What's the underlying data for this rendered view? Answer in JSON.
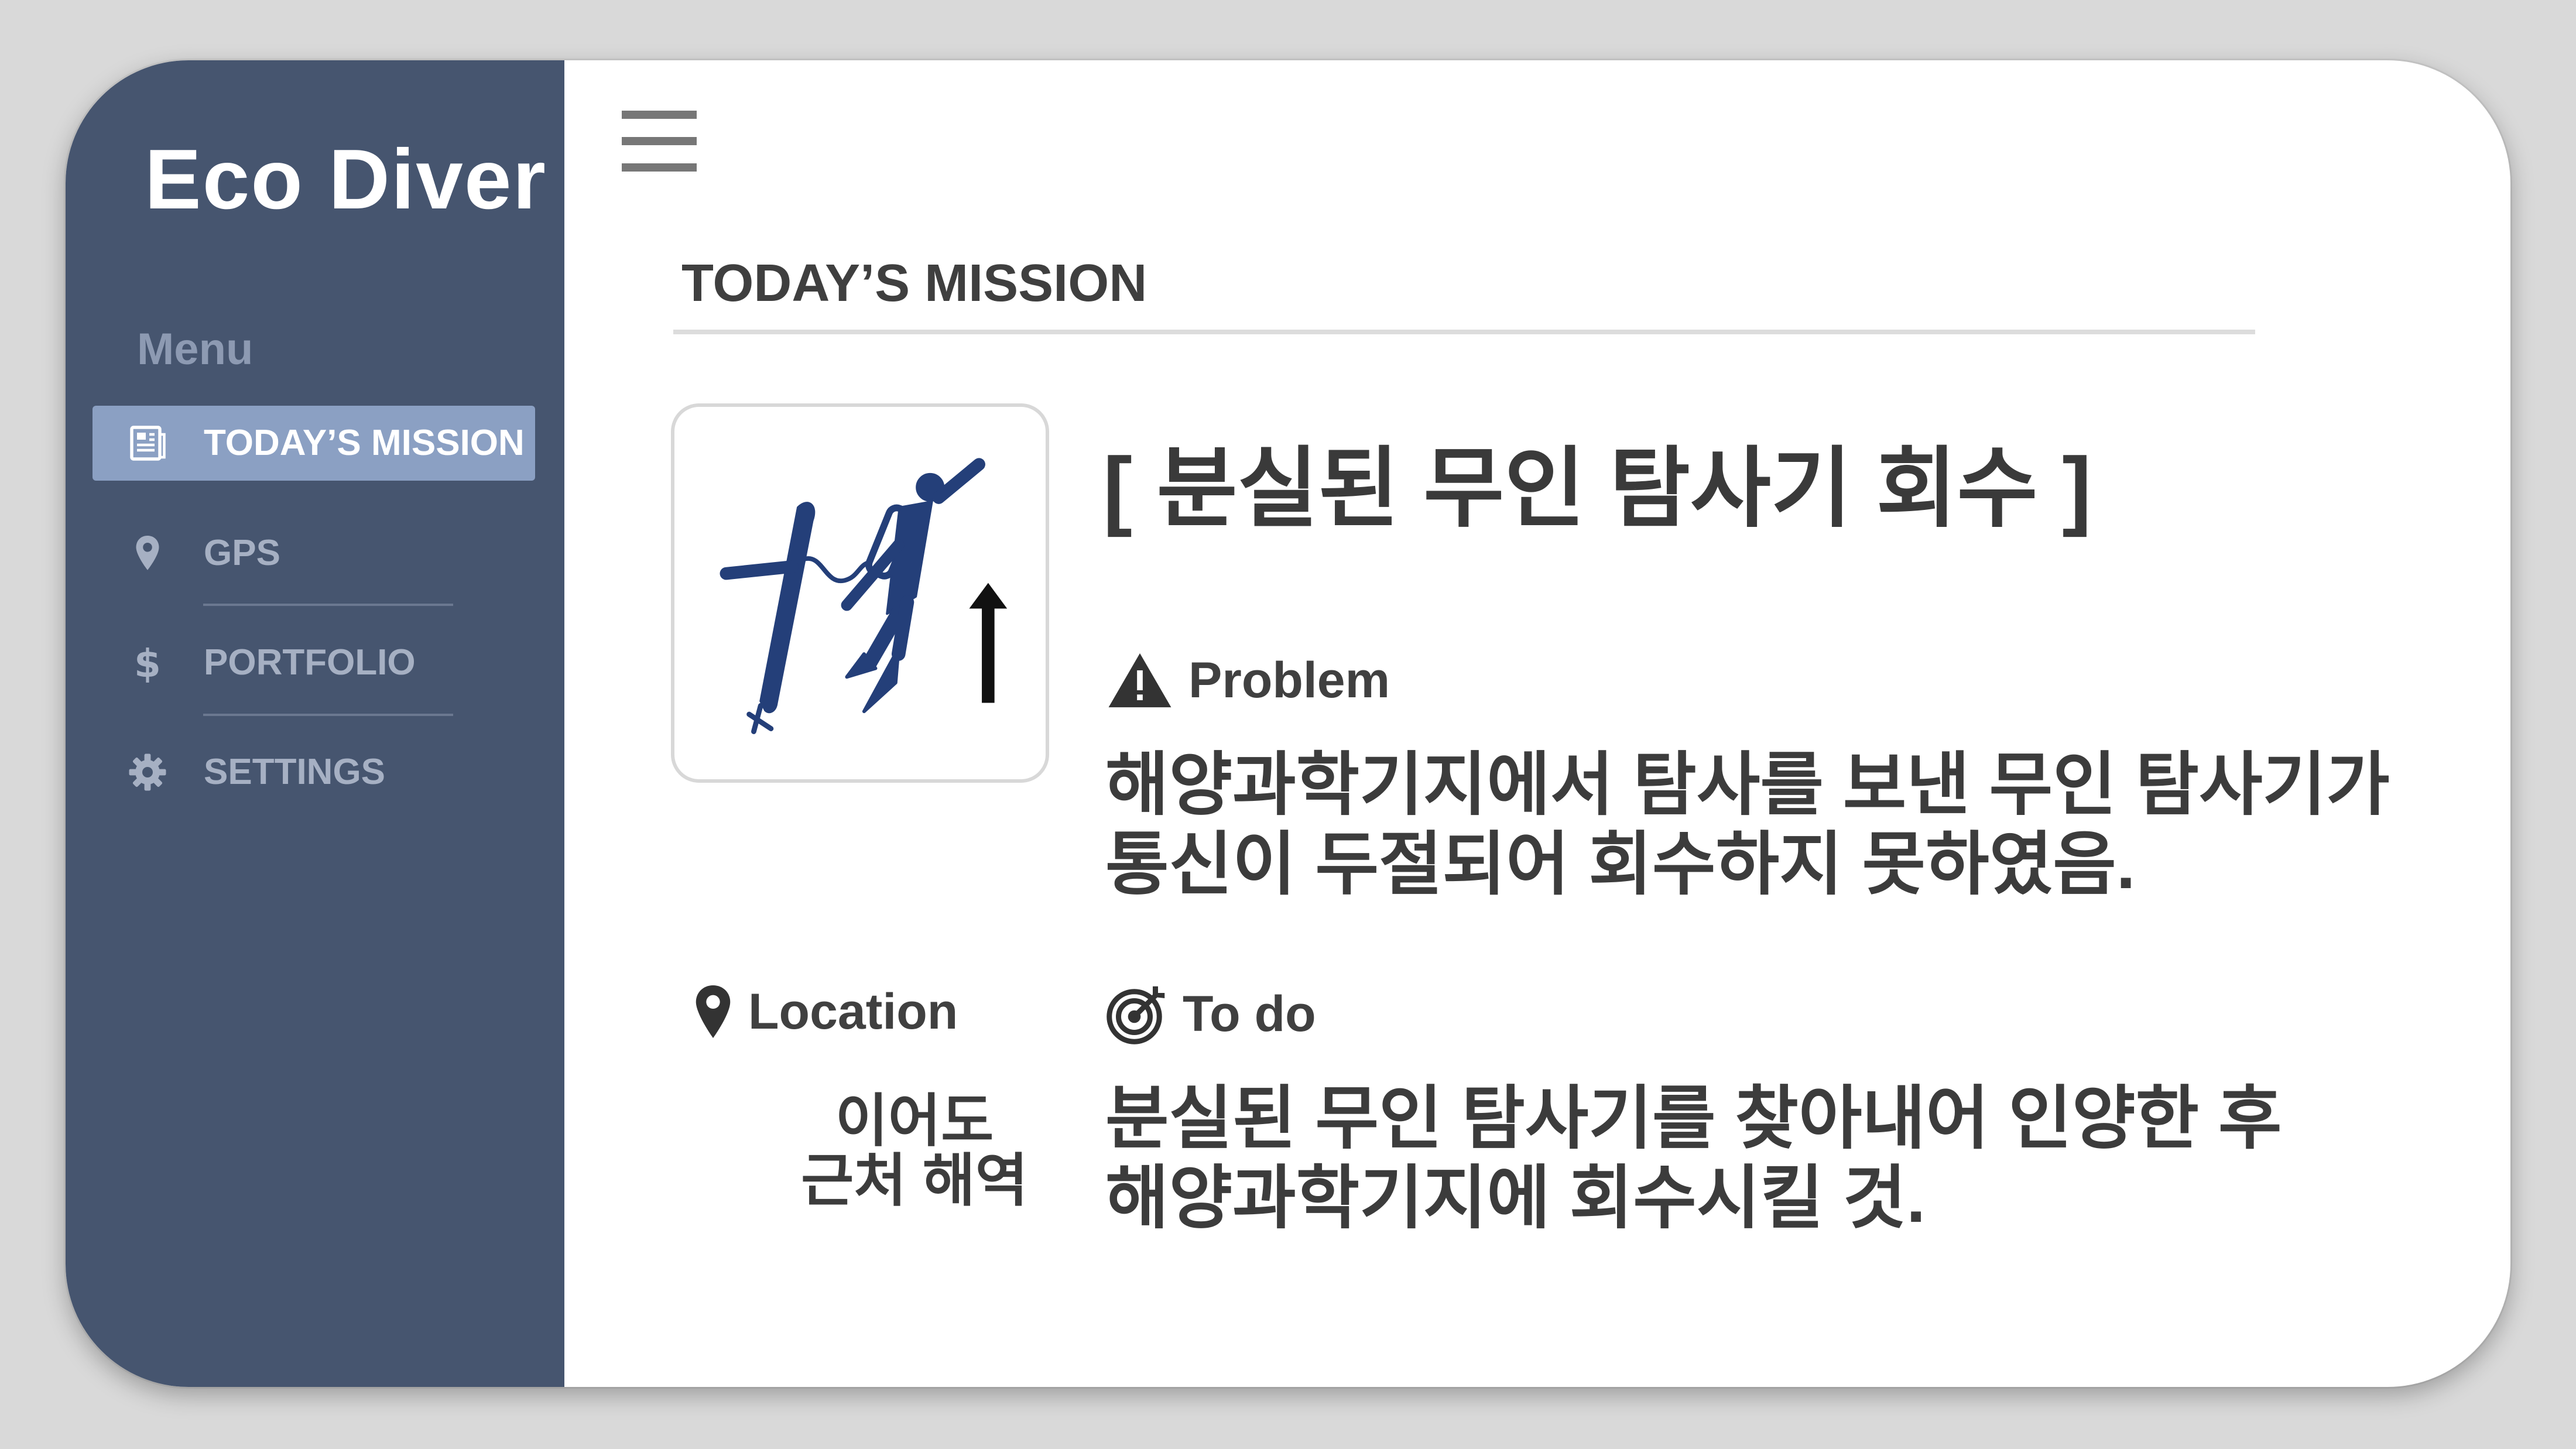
{
  "app": {
    "logo_text": "Eco Diver"
  },
  "sidebar": {
    "menu_label": "Menu",
    "items": [
      {
        "label": "TODAY’S MISSION",
        "icon": "newspaper-icon",
        "active": true
      },
      {
        "label": "GPS",
        "icon": "map-pin-icon",
        "active": false
      },
      {
        "label": "PORTFOLIO",
        "icon": "dollar-icon",
        "active": false
      },
      {
        "label": "SETTINGS",
        "icon": "gear-icon",
        "active": false
      }
    ]
  },
  "header": {
    "menu_icon": "hamburger-menu-icon"
  },
  "main": {
    "section_title": "TODAY’S MISSION",
    "mission": {
      "title": "[ 분실된 무인 탐사기 회수 ]",
      "image_icon": "diver-lifting-probe-icon",
      "problem_heading": "Problem",
      "problem_lines": [
        "해양과학기지에서 탐사를 보낸 무인 탐사기가",
        "통신이 두절되어 회수하지 못하였음."
      ],
      "location_heading": "Location",
      "location_lines": [
        "이어도",
        "근처 해역"
      ],
      "todo_heading": "To do",
      "todo_lines": [
        "분실된 무인 탐사기를 찾아내어 인양한 후",
        "해양과학기지에 회수시킬 것."
      ]
    }
  },
  "colors": {
    "sidebar_bg": "#46556f",
    "active_item_bg": "#8ba0c3",
    "page_bg": "#d9d9d9",
    "diver_blue": "#243f79"
  }
}
